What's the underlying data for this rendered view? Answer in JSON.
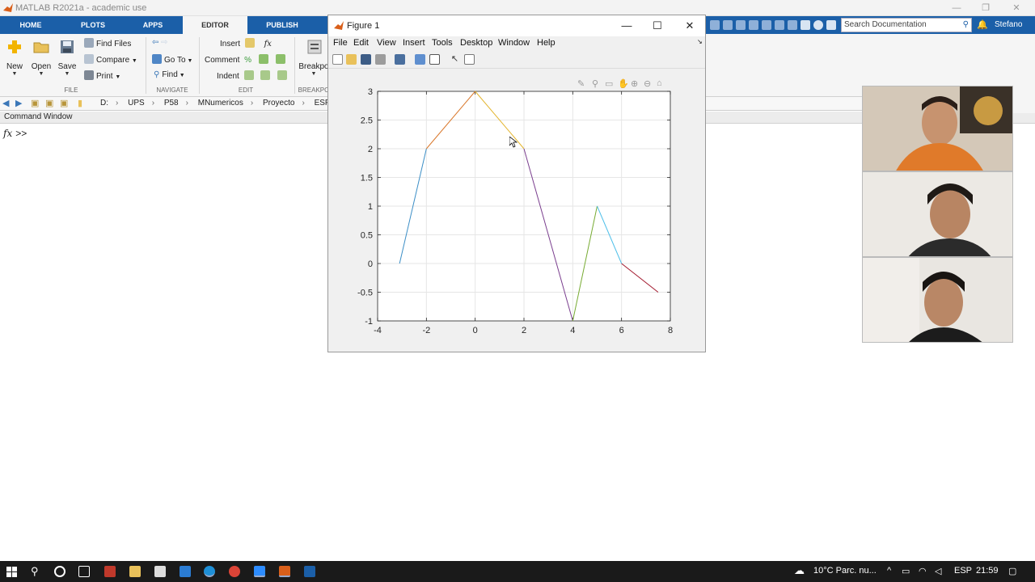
{
  "window": {
    "title": "MATLAB R2021a - academic use",
    "minimize": "—",
    "restore": "❐",
    "close": "✕"
  },
  "tabs": [
    "HOME",
    "PLOTS",
    "APPS",
    "EDITOR",
    "PUBLISH"
  ],
  "search": {
    "placeholder": "Search Documentation",
    "icon": "search-icon"
  },
  "user": "Stefano",
  "ribbon": {
    "file": {
      "new": "New",
      "open": "Open",
      "save": "Save",
      "find_files": "Find Files",
      "compare": "Compare",
      "print": "Print",
      "label": "FILE"
    },
    "navigate": {
      "goto": "Go To",
      "find": "Find",
      "label": "NAVIGATE"
    },
    "edit": {
      "insert": "Insert",
      "comment": "Comment",
      "indent": "Indent",
      "label": "EDIT"
    },
    "breakpoints": {
      "label_btn": "Breakpo",
      "label": "BREAKPO"
    }
  },
  "address": {
    "path": [
      "D:",
      "UPS",
      "P58",
      "MNumericos",
      "Proyecto",
      "ESPINOSA_M"
    ]
  },
  "command_window": {
    "header": "Command Window",
    "fx": "fx",
    "prompt": ">>"
  },
  "figure": {
    "title": "Figure 1",
    "menu": [
      "File",
      "Edit",
      "View",
      "Insert",
      "Tools",
      "Desktop",
      "Window",
      "Help"
    ],
    "window_min": "—",
    "window_max": "☐",
    "window_close": "✕"
  },
  "chart_data": {
    "type": "line",
    "title": "",
    "xlabel": "",
    "ylabel": "",
    "xlim": [
      -4,
      8
    ],
    "ylim": [
      -1,
      3
    ],
    "grid": true,
    "legend": "none",
    "x_ticks": [
      "-4",
      "-2",
      "0",
      "2",
      "4",
      "6",
      "8"
    ],
    "y_ticks": [
      "-1",
      "-0.5",
      "0",
      "0.5",
      "1",
      "1.5",
      "2",
      "2.5",
      "3"
    ],
    "segments": [
      {
        "x": [
          -3.1,
          -2
        ],
        "y": [
          0,
          2
        ],
        "color": "#3b8ec6"
      },
      {
        "x": [
          -2,
          0
        ],
        "y": [
          2,
          3
        ],
        "color": "#d9772a"
      },
      {
        "x": [
          0,
          2
        ],
        "y": [
          3,
          2
        ],
        "color": "#e3b42c"
      },
      {
        "x": [
          2,
          4
        ],
        "y": [
          2,
          -1
        ],
        "color": "#7a3e8e"
      },
      {
        "x": [
          4,
          5
        ],
        "y": [
          -1,
          1
        ],
        "color": "#77ab32"
      },
      {
        "x": [
          5,
          6
        ],
        "y": [
          1,
          0
        ],
        "color": "#4fbfe9"
      },
      {
        "x": [
          6,
          7.5
        ],
        "y": [
          0,
          -0.5
        ],
        "color": "#a2182d"
      }
    ]
  },
  "taskbar": {
    "weather": "10°C  Parc. nu...",
    "lang": "ESP",
    "time": "21:59"
  }
}
